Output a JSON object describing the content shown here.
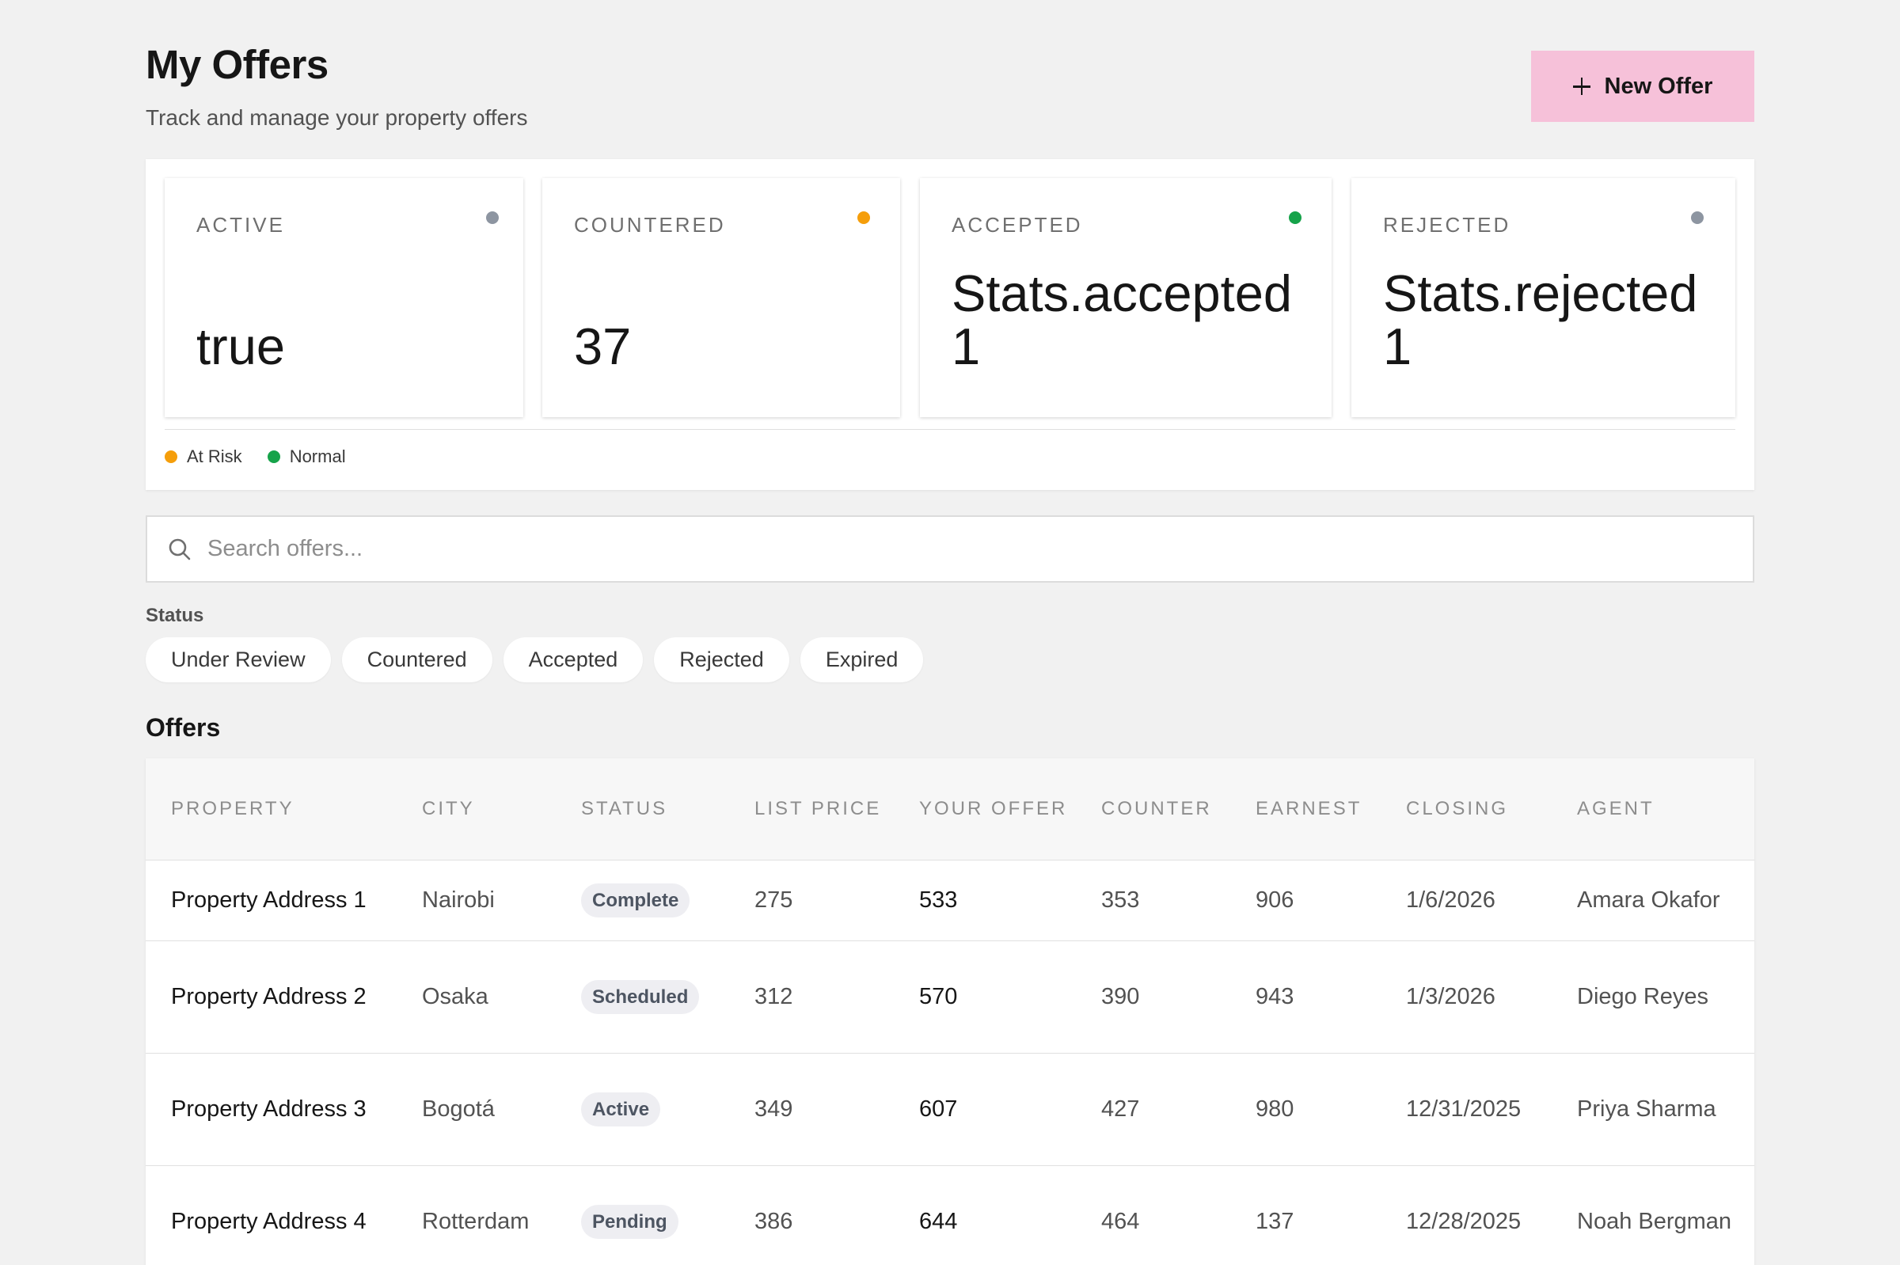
{
  "header": {
    "title": "My Offers",
    "subtitle": "Track and manage your property offers",
    "new_offer_label": "New Offer"
  },
  "stats": [
    {
      "label": "ACTIVE",
      "value": "true",
      "dot_color": "#8d95a1"
    },
    {
      "label": "COUNTERED",
      "value": "37",
      "dot_color": "#f59e0b"
    },
    {
      "label": "ACCEPTED",
      "value": "Stats.accepted\n1",
      "dot_color": "#16a34a"
    },
    {
      "label": "REJECTED",
      "value": "Stats.rejected\n1",
      "dot_color": "#8d95a1"
    }
  ],
  "legend": [
    {
      "label": "At Risk",
      "color": "#f59e0b"
    },
    {
      "label": "Normal",
      "color": "#16a34a"
    }
  ],
  "search": {
    "placeholder": "Search offers..."
  },
  "filter": {
    "label": "Status",
    "options": [
      "Under Review",
      "Countered",
      "Accepted",
      "Rejected",
      "Expired"
    ]
  },
  "offers": {
    "title": "Offers",
    "columns": [
      "PROPERTY",
      "CITY",
      "STATUS",
      "LIST PRICE",
      "YOUR OFFER",
      "COUNTER",
      "EARNEST",
      "CLOSING",
      "AGENT"
    ],
    "rows": [
      {
        "property": "Property Address 1",
        "city": "Nairobi",
        "status": "Complete",
        "list_price": "275",
        "your_offer": "533",
        "counter": "353",
        "earnest": "906",
        "closing": "1/6/2026",
        "agent": "Amara Okafor"
      },
      {
        "property": "Property Address 2",
        "city": "Osaka",
        "status": "Scheduled",
        "list_price": "312",
        "your_offer": "570",
        "counter": "390",
        "earnest": "943",
        "closing": "1/3/2026",
        "agent": "Diego Reyes"
      },
      {
        "property": "Property Address 3",
        "city": "Bogotá",
        "status": "Active",
        "list_price": "349",
        "your_offer": "607",
        "counter": "427",
        "earnest": "980",
        "closing": "12/31/2025",
        "agent": "Priya Sharma"
      },
      {
        "property": "Property Address 4",
        "city": "Rotterdam",
        "status": "Pending",
        "list_price": "386",
        "your_offer": "644",
        "counter": "464",
        "earnest": "137",
        "closing": "12/28/2025",
        "agent": "Noah Bergman"
      }
    ]
  },
  "colors": {
    "accent_button": "#f6c1d9",
    "background": "#f1f1f1"
  }
}
